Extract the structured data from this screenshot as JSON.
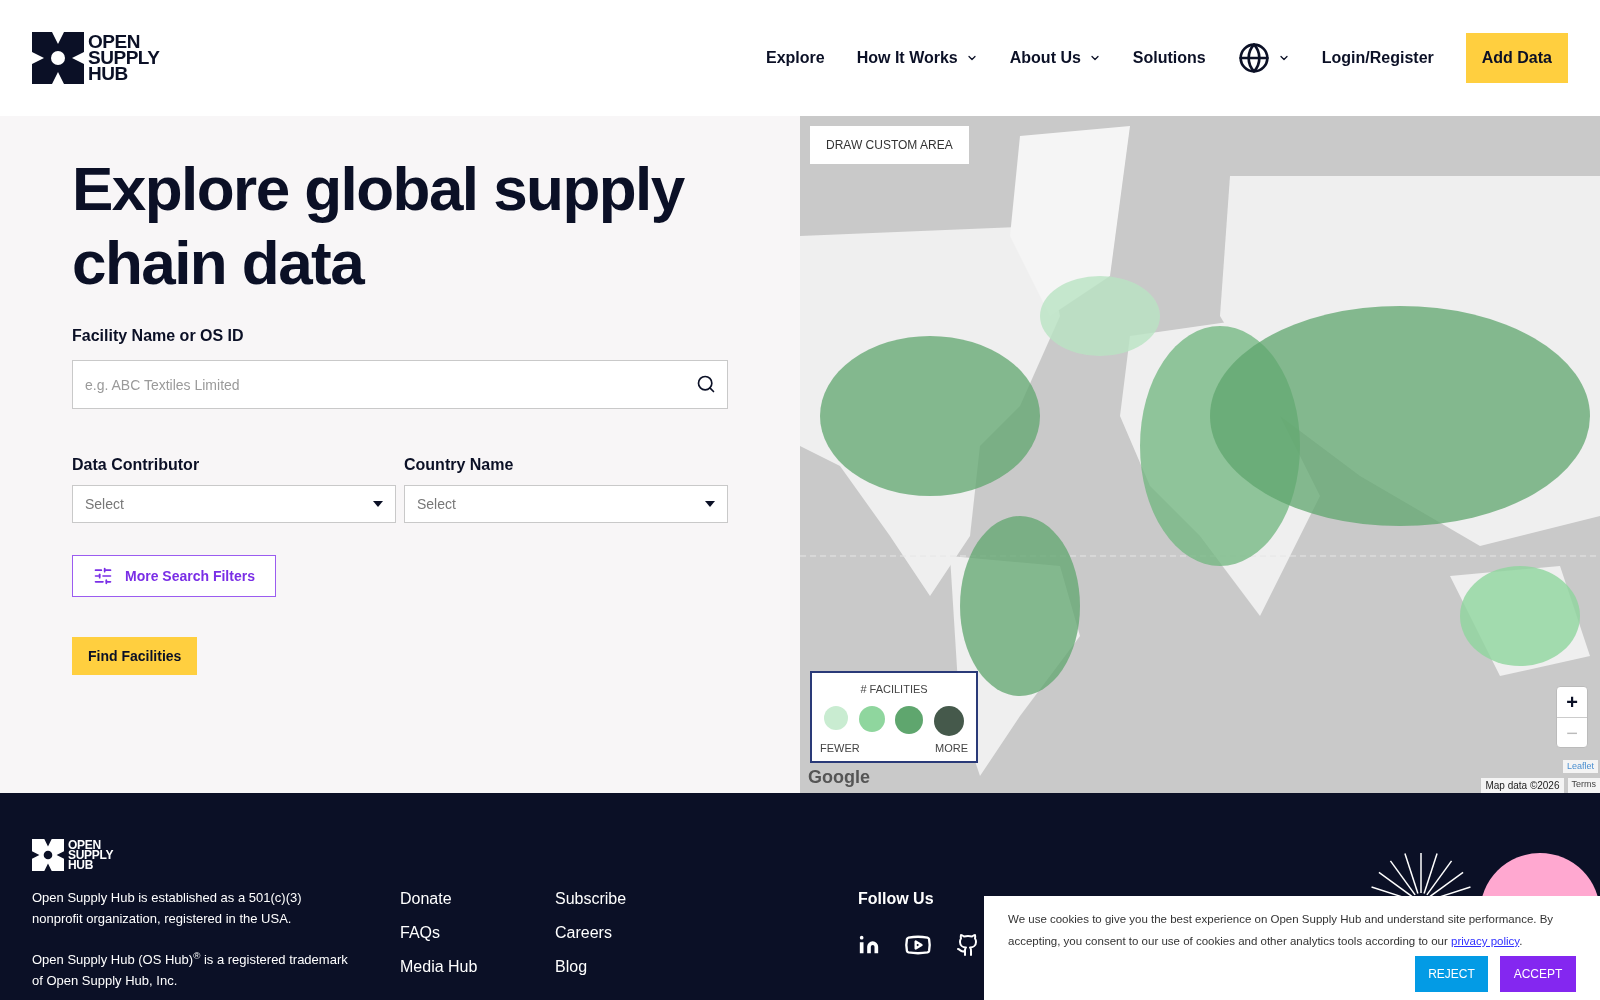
{
  "header": {
    "logo_lines": [
      "OPEN",
      "SUPPLY",
      "HUB"
    ],
    "nav": [
      {
        "label": "Explore",
        "dropdown": false
      },
      {
        "label": "How It Works",
        "dropdown": true
      },
      {
        "label": "About Us",
        "dropdown": true
      },
      {
        "label": "Solutions",
        "dropdown": false
      }
    ],
    "language": {
      "dropdown": true
    },
    "login": "Login/Register",
    "cta": "Add Data"
  },
  "search": {
    "title": "Explore global supply chain data",
    "name_label": "Facility Name or OS ID",
    "name_placeholder": "e.g. ABC Textiles Limited",
    "selects": [
      {
        "label": "Data Contributor",
        "placeholder": "Select"
      },
      {
        "label": "Country Name",
        "placeholder": "Select"
      }
    ],
    "more_filters": "More Search Filters",
    "submit": "Find Facilities"
  },
  "map": {
    "draw_button": "DRAW CUSTOM AREA",
    "legend": {
      "title": "# FACILITIES",
      "swatches": [
        {
          "color": "#c9ecd1"
        },
        {
          "color": "#8fd69e"
        },
        {
          "color": "#5fa66e"
        },
        {
          "color": "#45594b"
        }
      ],
      "low": "FEWER",
      "high": "MORE"
    },
    "zoom_in": "+",
    "zoom_out": "−",
    "google": "Google",
    "attribution": "Map data ©2026",
    "terms": "Terms",
    "leaflet": "Leaflet"
  },
  "footer": {
    "logo_lines": [
      "OPEN",
      "SUPPLY",
      "HUB"
    ],
    "paragraphs": [
      "Open Supply Hub is established as a 501(c)(3) nonprofit organization, registered in the USA.",
      "Open Supply Hub (OS Hub)$^{®}$ is a registered trademark of Open Supply Hub, Inc."
    ],
    "links_1": [
      "Donate",
      "FAQs",
      "Media Hub"
    ],
    "links_2": [
      "Subscribe",
      "Careers",
      "Blog"
    ],
    "follow": "Follow Us"
  },
  "cookie": {
    "text": "We use cookies to give you the best experience on Open Supply Hub and understand site performance. By accepting, you consent to our use of cookies and other analytics tools according to our",
    "link": "privacy policy",
    "end": ".",
    "reject": "REJECT",
    "accept": "ACCEPT"
  }
}
